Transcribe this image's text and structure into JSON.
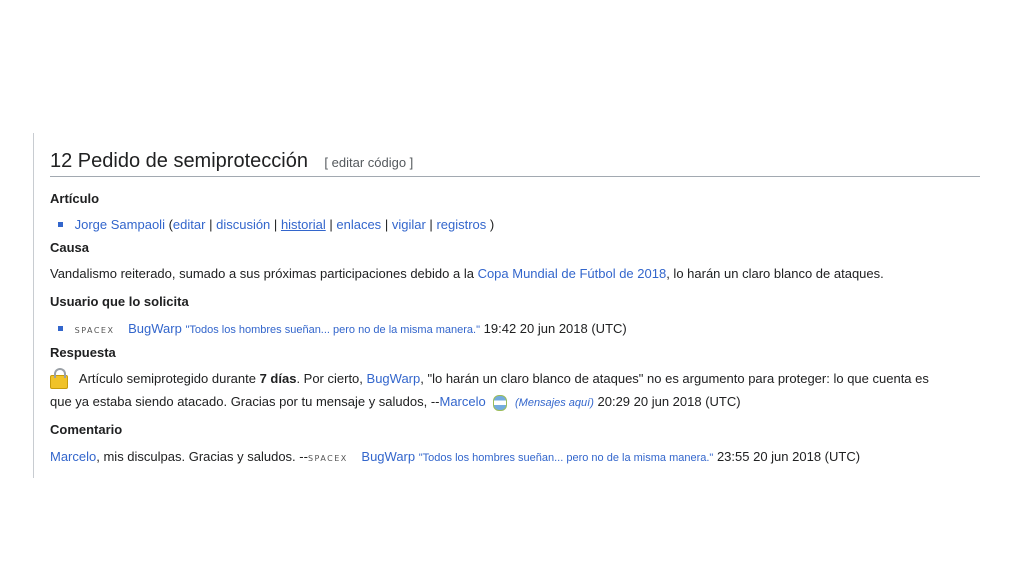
{
  "section": {
    "title": "12 Pedido de semiprotección",
    "edit_label": "[ editar código ]"
  },
  "articulo": {
    "label": "Artículo",
    "page": "Jorge Sampaoli",
    "open": "(",
    "links": [
      "editar",
      "discusión",
      "historial",
      "enlaces",
      "vigilar",
      "registros"
    ],
    "sep": "|",
    "close": ")"
  },
  "causa": {
    "label": "Causa",
    "text_before": "Vandalismo reiterado, sumado a sus próximas participaciones debido a la",
    "link": "Copa Mundial de Fútbol de 2018",
    "text_after": ", lo harán un claro blanco de ataques."
  },
  "usuario": {
    "label": "Usuario que lo solicita",
    "logo_text": "SPACEX",
    "user": "BugWarp",
    "motto": "\"Todos los hombres sueñan... pero no de la misma manera.\"",
    "timestamp": "19:42 20 jun 2018 (UTC)"
  },
  "respuesta": {
    "label": "Respuesta",
    "text1": "Artículo semiprotegido durante",
    "bold": "7 días",
    "text2": ". Por cierto,",
    "user": "BugWarp",
    "text3": ", \"lo harán un claro blanco de ataques\" no es argumento para proteger: lo que cuenta es",
    "line2": "que ya estaba siendo atacado. Gracias por tu mensaje y saludos, --",
    "signer": "Marcelo",
    "talk": "(Mensajes aquí)",
    "timestamp": "20:29 20 jun 2018 (UTC)"
  },
  "comentario": {
    "label": "Comentario",
    "user_link": "Marcelo",
    "text": ", mis disculpas. Gracias y saludos. --",
    "logo_text": "SPACEX",
    "user": "BugWarp",
    "motto": "\"Todos los hombres sueñan... pero no de la misma manera.\"",
    "timestamp": "23:55 20 jun 2018 (UTC)"
  }
}
